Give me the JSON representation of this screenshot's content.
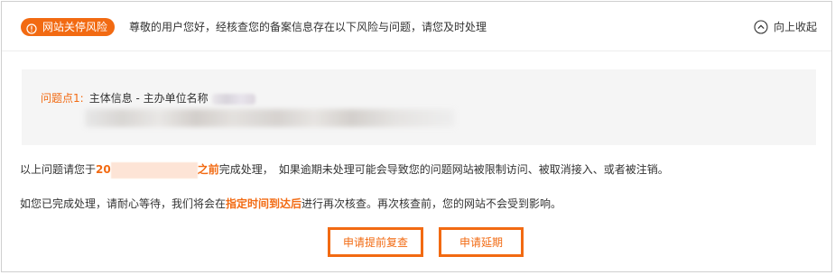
{
  "header": {
    "badge_label": "网站关停风险",
    "badge_icon": "warning-circle-icon",
    "intro_text": "尊敬的用户您好，经核查您的备案信息存在以下风险与问题，请您及时处理",
    "collapse_label": "向上收起",
    "collapse_icon": "chevron-up-circle-icon"
  },
  "issue": {
    "label": "问题点1:",
    "text": "主体信息 - 主办单位名称"
  },
  "deadline_notice": {
    "prefix": "以上问题请您于",
    "date_visible_prefix": "20",
    "date_suffix": "之前",
    "middle": "完成处理，",
    "warning": "如果逾期未处理可能会导致您的问题网站被限制访问、被取消接入、或者被注销。"
  },
  "recheck_notice": {
    "prefix": "如您已完成处理，请耐心等待，我们将会在",
    "highlight": "指定时间到达后",
    "suffix": "进行再次核查。再次核查前，您的网站不会受到影响。"
  },
  "buttons": {
    "request_review": "申请提前复查",
    "request_extension": "申请延期"
  },
  "colors": {
    "accent": "#f26a12",
    "text": "#333333",
    "panel_bg": "#f5f5f5",
    "border": "#cfcfcf"
  }
}
